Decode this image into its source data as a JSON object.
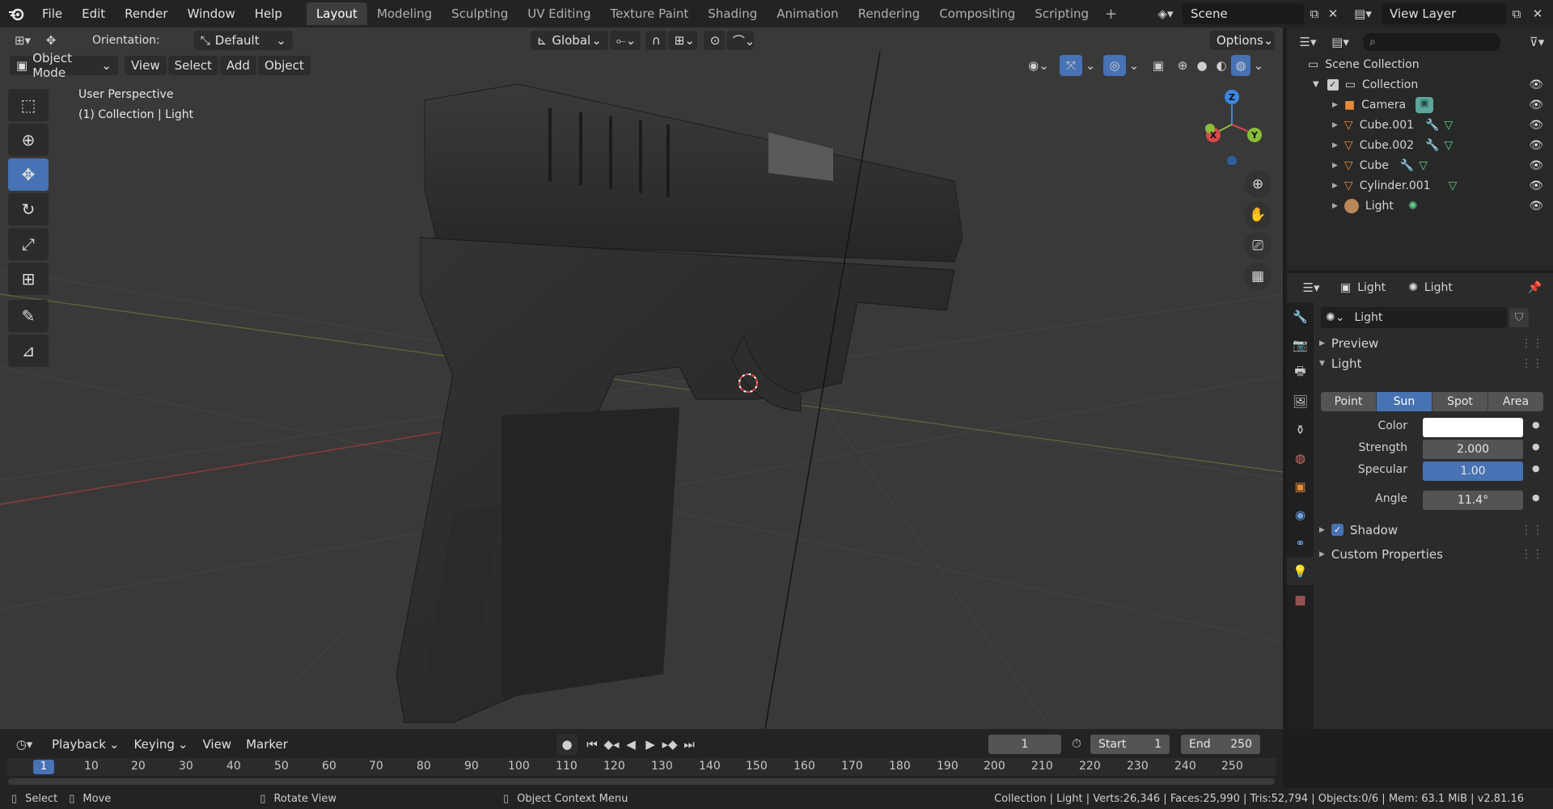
{
  "menu": {
    "file": "File",
    "edit": "Edit",
    "render": "Render",
    "window": "Window",
    "help": "Help"
  },
  "workspaces": [
    "Layout",
    "Modeling",
    "Sculpting",
    "UV Editing",
    "Texture Paint",
    "Shading",
    "Animation",
    "Rendering",
    "Compositing",
    "Scripting"
  ],
  "scene": {
    "name": "Scene",
    "view_layer": "View Layer"
  },
  "viewport": {
    "orientation_label": "Orientation:",
    "orientation_value": "Default",
    "transform_space": "Global",
    "options": "Options",
    "mode": "Object Mode",
    "view": "View",
    "select": "Select",
    "add": "Add",
    "object": "Object",
    "perspective": "User Perspective",
    "context": "(1) Collection | Light",
    "gizmo_z": "Z",
    "gizmo_y": "Y",
    "gizmo_x": "X"
  },
  "outliner": {
    "root": "Scene Collection",
    "collection": "Collection",
    "items": [
      {
        "name": "Camera",
        "icon": "camera-icon"
      },
      {
        "name": "Cube.001",
        "icon": "mesh-icon"
      },
      {
        "name": "Cube.002",
        "icon": "mesh-icon"
      },
      {
        "name": "Cube",
        "icon": "mesh-icon"
      },
      {
        "name": "Cylinder.001",
        "icon": "mesh-icon"
      },
      {
        "name": "Light",
        "icon": "light-icon"
      }
    ]
  },
  "properties": {
    "breadcrumb_object": "Light",
    "breadcrumb_data": "Light",
    "datablock": "Light",
    "preview": "Preview",
    "light_panel": "Light",
    "types": [
      "Point",
      "Sun",
      "Spot",
      "Area"
    ],
    "active_type": "Sun",
    "color_label": "Color",
    "color_value": "#ffffff",
    "strength_label": "Strength",
    "strength_value": "2.000",
    "specular_label": "Specular",
    "specular_value": "1.00",
    "angle_label": "Angle",
    "angle_value": "11.4°",
    "shadow": "Shadow",
    "custom": "Custom Properties"
  },
  "timeline": {
    "playback": "Playback",
    "keying": "Keying",
    "view": "View",
    "marker": "Marker",
    "current_frame": "1",
    "start_label": "Start",
    "start": "1",
    "end_label": "End",
    "end": "250",
    "ticks": [
      "1",
      "10",
      "20",
      "30",
      "40",
      "50",
      "60",
      "70",
      "80",
      "90",
      "100",
      "110",
      "120",
      "130",
      "140",
      "150",
      "160",
      "170",
      "180",
      "190",
      "200",
      "210",
      "220",
      "230",
      "240",
      "250"
    ]
  },
  "status": {
    "select": "Select",
    "move": "Move",
    "rotate": "Rotate View",
    "context": "Object Context Menu",
    "stats": "Collection | Light | Verts:26,346 | Faces:25,990 | Tris:52,794 | Objects:0/6 | Mem: 63.1 MiB | v2.81.16"
  },
  "colors": {
    "accent": "#4772b3",
    "viewport_bg": "#393939",
    "panel_bg": "#2b2b2b",
    "header_bg": "#232323",
    "mesh_orange": "#e58a3a",
    "data_green": "#5fcf8a"
  }
}
